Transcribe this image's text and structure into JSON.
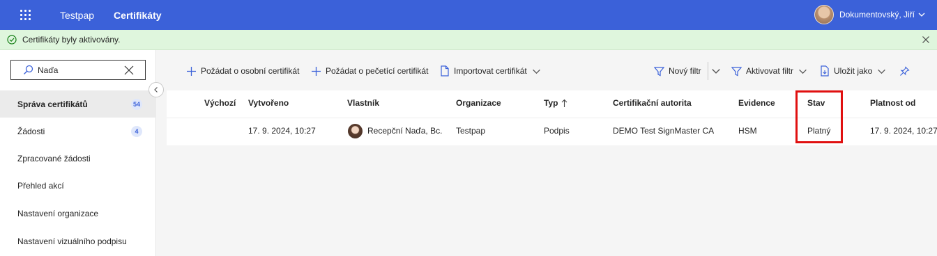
{
  "header": {
    "app_name": "Testpap",
    "section": "Certifikáty",
    "user_name": "Dokumentovský, Jiří"
  },
  "notice": {
    "text": "Certifikáty byly aktivovány."
  },
  "sidebar": {
    "search_value": "Naďa",
    "items": [
      {
        "label": "Správa certifikátů",
        "badge": "54"
      },
      {
        "label": "Žádosti",
        "badge": "4"
      },
      {
        "label": "Zpracované žádosti"
      },
      {
        "label": "Přehled akcí"
      },
      {
        "label": "Nastavení organizace"
      },
      {
        "label": "Nastavení vizuálního podpisu"
      }
    ]
  },
  "commands": {
    "request_personal": "Požádat o osobní certifikát",
    "request_seal": "Požádat o pečetící certifikát",
    "import": "Importovat certifikát",
    "new_filter": "Nový filtr",
    "activate_filter": "Aktivovat filtr",
    "save_as": "Uložit jako"
  },
  "table": {
    "columns": [
      "Výchozí",
      "Vytvořeno",
      "Vlastník",
      "Organizace",
      "Typ",
      "Certifikační autorita",
      "Evidence",
      "Stav",
      "Platnost od"
    ],
    "rows": [
      {
        "default": "",
        "created": "17. 9. 2024, 10:27",
        "owner": "Recepční Naďa, Bc.",
        "organization": "Testpap",
        "type": "Podpis",
        "authority": "DEMO Test SignMaster CA",
        "evidence": "HSM",
        "status": "Platný",
        "valid_from": "17. 9. 2024, 10:27"
      }
    ]
  },
  "colors": {
    "header_bg": "#3b61d9",
    "notice_bg": "#dff6dd",
    "highlight": "#e01010"
  }
}
